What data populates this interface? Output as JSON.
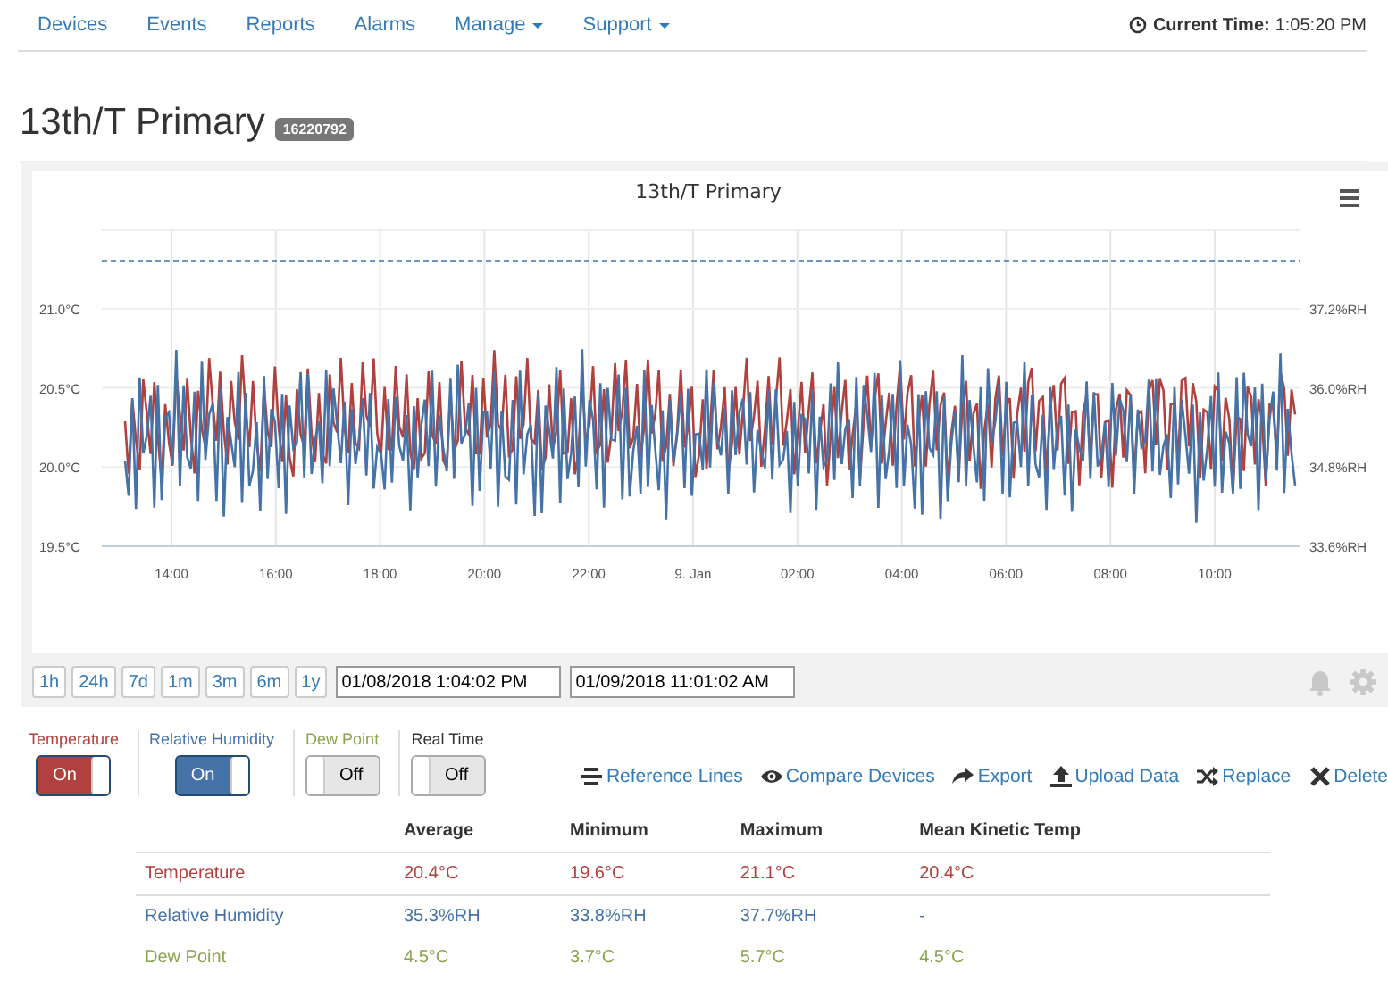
{
  "nav": {
    "items": [
      {
        "label": "Devices",
        "dropdown": false
      },
      {
        "label": "Events",
        "dropdown": false
      },
      {
        "label": "Reports",
        "dropdown": false
      },
      {
        "label": "Alarms",
        "dropdown": false
      },
      {
        "label": "Manage",
        "dropdown": true
      },
      {
        "label": "Support",
        "dropdown": true
      }
    ],
    "clock": {
      "label": "Current Time:",
      "value": "1:05:20 PM"
    }
  },
  "page": {
    "title": "13th/T Primary",
    "badge": "16220792"
  },
  "chart": {
    "title": "13th/T Primary",
    "yticks_left": [
      "21.0°C",
      "20.5°C",
      "20.0°C",
      "19.5°C"
    ],
    "yticks_right": [
      "37.2%RH",
      "36.0%RH",
      "34.8%RH",
      "33.6%RH"
    ],
    "xticks": [
      "14:00",
      "16:00",
      "18:00",
      "20:00",
      "22:00",
      "9. Jan",
      "02:00",
      "04:00",
      "06:00",
      "08:00",
      "10:00"
    ],
    "lines": [
      {
        "color": "#b0413e"
      },
      {
        "color": "#4572a7"
      }
    ]
  },
  "ranges": [
    "1h",
    "24h",
    "7d",
    "1m",
    "3m",
    "6m",
    "1y"
  ],
  "date_from": "01/08/2018 1:04:02 PM",
  "date_to": "01/09/2018 11:01:02 AM",
  "toggles": [
    {
      "label": "Temperature",
      "color": "#b0413e",
      "on": true,
      "text": "On"
    },
    {
      "label": "Relative Humidity",
      "color": "#4572a7",
      "on": true,
      "text": "On"
    },
    {
      "label": "Dew Point",
      "color": "#89a54e",
      "on": false,
      "text": "Off"
    },
    {
      "label": "Real Time",
      "color": "#333333",
      "on": false,
      "text": "Off"
    }
  ],
  "actions": [
    {
      "label": "Reference Lines",
      "kind": "lines"
    },
    {
      "label": "Compare Devices",
      "kind": "eye"
    },
    {
      "label": "Export",
      "kind": "share"
    },
    {
      "label": "Upload Data",
      "kind": "upload"
    },
    {
      "label": "Replace",
      "kind": "shuffle"
    },
    {
      "label": "Delete",
      "kind": "delete"
    }
  ],
  "table": {
    "columns": [
      "Average",
      "Minimum",
      "Maximum",
      "Mean Kinetic Temp"
    ],
    "rows": [
      {
        "name": "Temperature",
        "color": "#b0413e",
        "cells": [
          "20.4°C",
          "19.6°C",
          "21.1°C",
          "20.4°C"
        ]
      },
      {
        "name": "Relative Humidity",
        "color": "#4572a7",
        "cells": [
          "35.3%RH",
          "33.8%RH",
          "37.7%RH",
          "-"
        ]
      },
      {
        "name": "Dew Point",
        "color": "#89a54e",
        "cells": [
          "4.5°C",
          "3.7°C",
          "5.7°C",
          "4.5°C"
        ]
      }
    ]
  }
}
